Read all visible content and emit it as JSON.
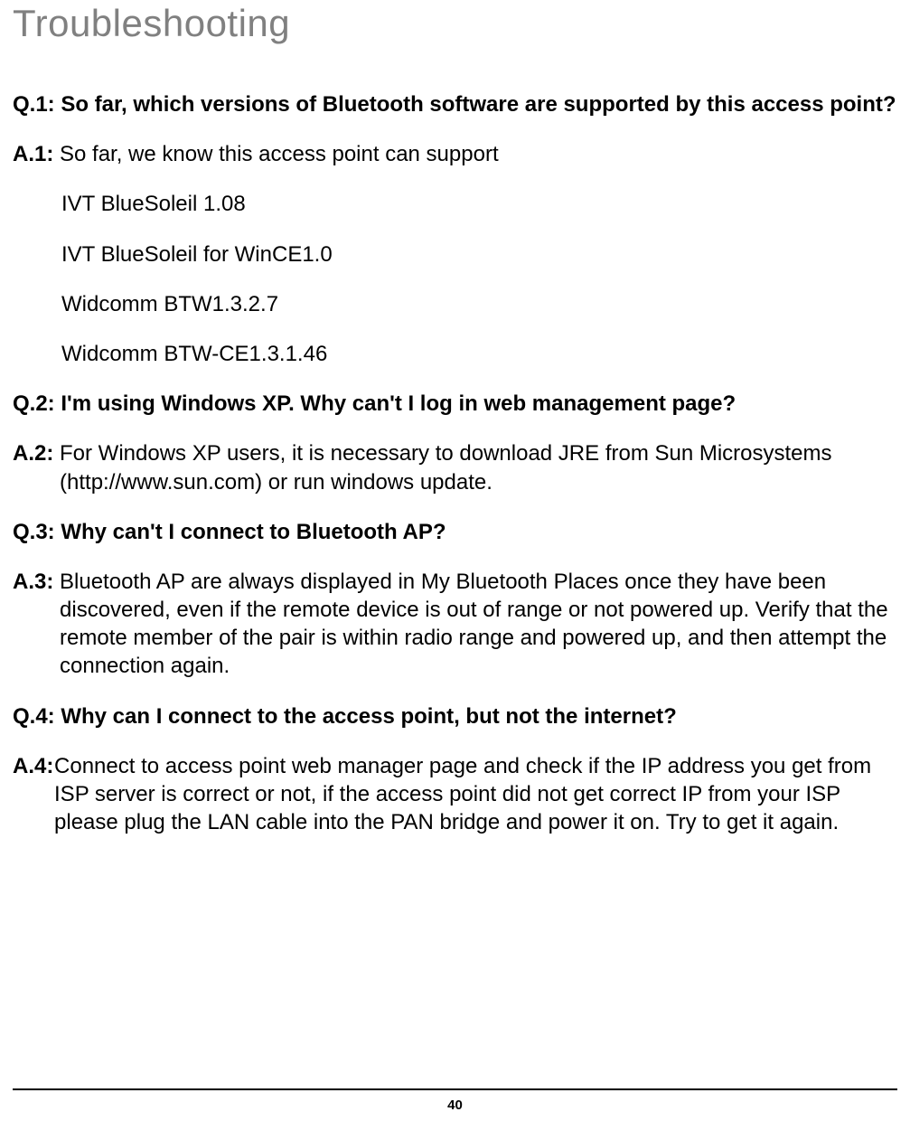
{
  "title": "Troubleshooting",
  "qa": [
    {
      "qLabel": "Q.1: ",
      "qText": "So far, which versions of Bluetooth software are supported by this access point?",
      "aLabel": "A.1: ",
      "aText": "So far, we know this access point can support",
      "subItems": [
        "IVT BlueSoleil 1.08",
        "IVT BlueSoleil for WinCE1.0",
        "Widcomm BTW1.3.2.7",
        "Widcomm BTW-CE1.3.1.46"
      ]
    },
    {
      "qLabel": "Q.2: ",
      "qText": "I'm using Windows XP. Why can't I log in web management page?",
      "aLabel": "A.2: ",
      "aText": "For Windows XP users, it is necessary to download JRE from Sun Microsystems (http://www.sun.com) or run windows update.",
      "subItems": []
    },
    {
      "qLabel": "Q.3: ",
      "qText": "Why can't I connect to Bluetooth AP?",
      "aLabel": "A.3: ",
      "aText": "Bluetooth AP are always displayed in My Bluetooth Places once they have been discovered, even if the remote device is out of range or not powered up. Verify that the remote member of the pair is within radio range and powered up, and then attempt the connection again.",
      "subItems": []
    },
    {
      "qLabel": "Q.4: ",
      "qText": "Why can I connect to the access point, but not the internet?",
      "aLabel": "A.4: ",
      "aText": "Connect to access point web manager page and check if the IP address you get from ISP server is correct or not, if the access point did not get correct IP from your ISP please plug the LAN cable into the PAN bridge and power it on. Try to get it again.",
      "aLabelNoSpace": true,
      "subItems": []
    }
  ],
  "pageNumber": "40"
}
